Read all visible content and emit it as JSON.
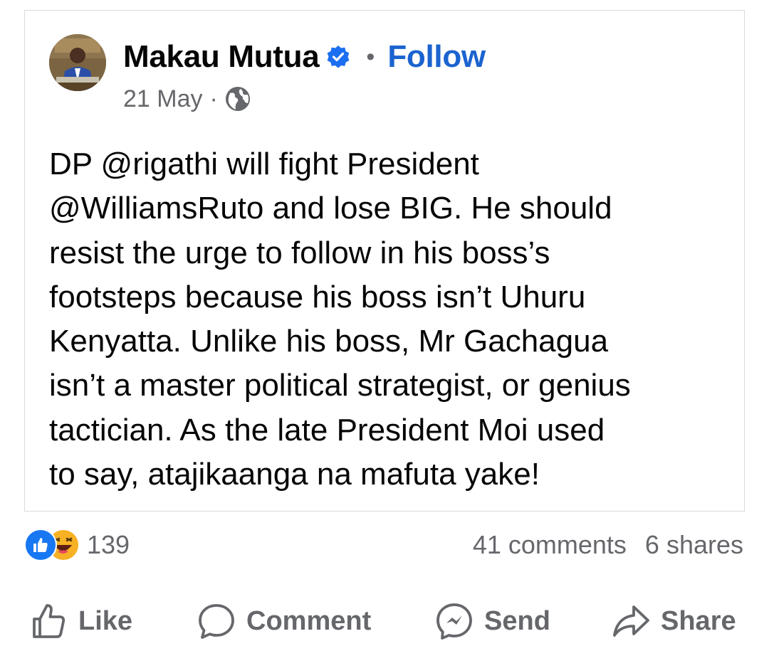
{
  "post": {
    "author_name": "Makau Mutua",
    "separator_dot": "•",
    "follow_label": "Follow",
    "date": "21 May",
    "meta_separator": "·",
    "text_lines": [
      "DP @rigathi will fight President",
      "@WilliamsRuto and lose BIG.  He should",
      "resist the urge to follow in his boss’s",
      "footsteps because his boss isn’t Uhuru",
      "Kenyatta.  Unlike his boss, Mr Gachagua",
      "isn’t a master political strategist, or genius",
      "tactician.  As the late President Moi used",
      "to say, atajikaanga na mafuta yake!"
    ]
  },
  "engagement": {
    "reaction_count": "139",
    "comments": "41 comments",
    "shares": "6 shares"
  },
  "actions": {
    "like": "Like",
    "comment": "Comment",
    "send": "Send",
    "share": "Share"
  },
  "icons": {
    "verified": "verified-badge-icon",
    "audience": "globe-icon",
    "reaction_like": "like-reaction-icon",
    "reaction_haha": "haha-reaction-icon",
    "like": "thumbs-up-icon",
    "comment": "comment-bubble-icon",
    "send": "messenger-icon",
    "share": "share-arrow-icon"
  },
  "colors": {
    "accent": "#1b63cf",
    "muted": "#65676b",
    "text": "#050505",
    "like_reaction": "#1877f2",
    "haha_reaction": "#f7b125"
  }
}
